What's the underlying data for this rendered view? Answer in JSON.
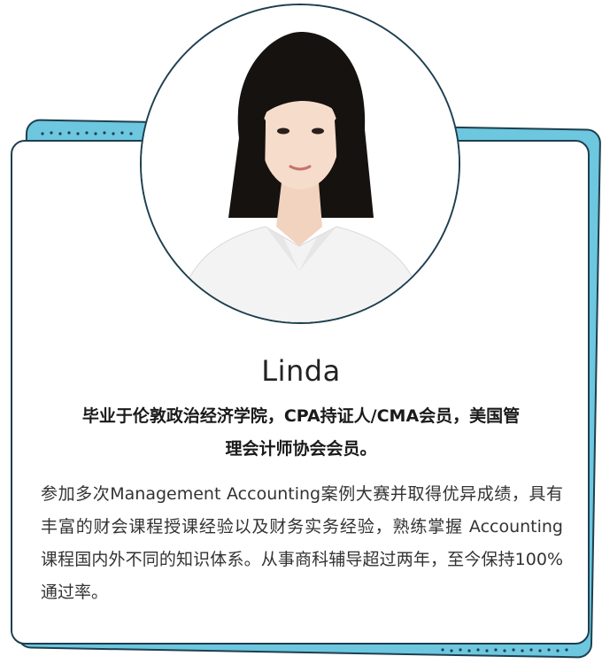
{
  "profile": {
    "name": "Linda",
    "title": "毕业于伦敦政治经济学院，CPA持证人/CMA会员，美国管理会计师协会会员。",
    "bio": "参加多次Management Accounting案例大赛并取得优异成绩，具有丰富的财会课程授课经验以及财务实务经验，熟练掌握 Accounting 课程国内外不同的知识体系。从事商科辅导超过两年，至今保持100%通过率。"
  },
  "colors": {
    "accent": "#6cc7df",
    "outline": "#1f3f4f",
    "card": "#ffffff"
  },
  "icons": {
    "avatar": "portrait-photo"
  }
}
